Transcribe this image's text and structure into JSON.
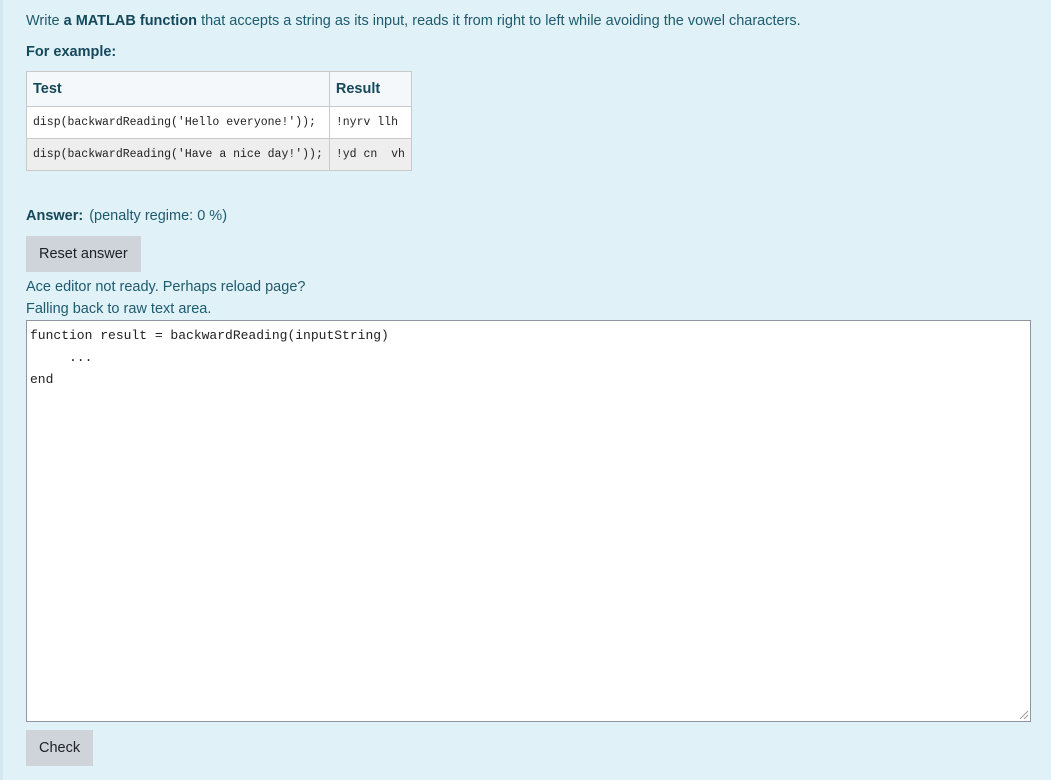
{
  "question": {
    "prompt_prefix": "Write ",
    "prompt_bold": "a MATLAB function",
    "prompt_suffix": " that accepts a string as its input, reads it from right to left while avoiding the vowel characters.",
    "example_label": "For example:"
  },
  "examples_table": {
    "headers": [
      "Test",
      "Result"
    ],
    "rows": [
      {
        "test": "disp(backwardReading('Hello everyone!'));",
        "result": "!nyrv llh"
      },
      {
        "test": "disp(backwardReading('Have a nice day!'));",
        "result": "!yd cn  vh"
      }
    ]
  },
  "answer": {
    "label": "Answer:",
    "penalty": "(penalty regime: 0 %)",
    "reset_button": "Reset answer",
    "editor_notice_1": "Ace editor not ready. Perhaps reload page?",
    "editor_notice_2": "Falling back to raw text area.",
    "code": "function result = backwardReading(inputString)\n     ...\nend"
  },
  "check_button": "Check",
  "colors": {
    "panel_background": "#e0f1f7",
    "heading_text": "#14485a",
    "body_text": "#1e5b6e",
    "button_background": "#ced4da"
  }
}
